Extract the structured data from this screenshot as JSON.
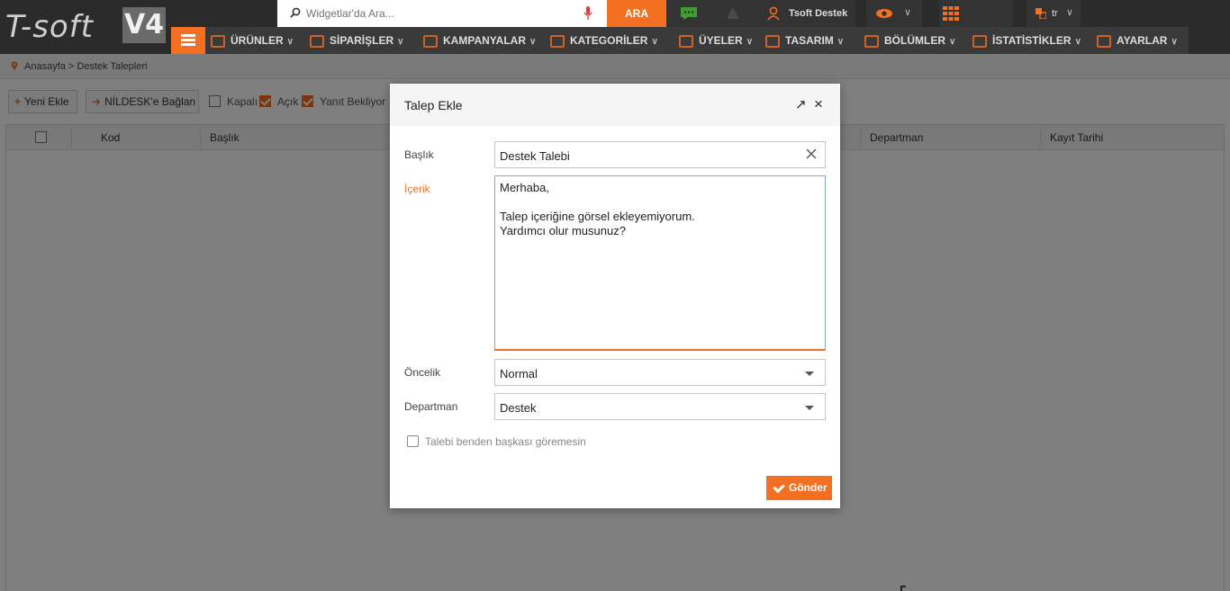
{
  "brand": {
    "logo_text": "T-soft",
    "version": "V4"
  },
  "search": {
    "placeholder": "Widgetlar'da Ara...",
    "button_label": "ARA"
  },
  "user": {
    "name": "Tsoft Destek"
  },
  "language": {
    "code": "tr"
  },
  "nav": {
    "items": [
      {
        "label": "ÜRÜNLER"
      },
      {
        "label": "SİPARİŞLER"
      },
      {
        "label": "KAMPANYALAR"
      },
      {
        "label": "KATEGORİLER"
      },
      {
        "label": "ÜYELER"
      },
      {
        "label": "TASARIM"
      },
      {
        "label": "BÖLÜMLER"
      },
      {
        "label": "İSTATİSTİKLER"
      },
      {
        "label": "AYARLAR"
      }
    ]
  },
  "breadcrumb": {
    "text": "Anasayfa > Destek Talepleri"
  },
  "toolbar": {
    "new_label": "Yeni Ekle",
    "connect_label": "NİLDESK'e Bağlan",
    "filters": [
      {
        "label": "Kapalı",
        "checked": false
      },
      {
        "label": "Açık",
        "checked": true
      },
      {
        "label": "Yanıt Bekliyor",
        "checked": true
      }
    ]
  },
  "grid": {
    "columns": [
      "Kod",
      "Başlık",
      "Departman",
      "Kayıt Tarihi"
    ]
  },
  "modal": {
    "title": "Talep Ekle",
    "fields": {
      "title_label": "Başlık",
      "title_value": "Destek Talebi",
      "content_label": "İçerik",
      "content_value": "Merhaba,\n\nTalep içeriğine görsel ekleyemiyorum.\nYardımcı olur musunuz?",
      "priority_label": "Öncelik",
      "priority_value": "Normal",
      "department_label": "Departman",
      "department_value": "Destek"
    },
    "private_label": "Talebi benden başkası göremesin",
    "private_checked": false,
    "submit_label": "Gönder"
  },
  "colors": {
    "accent": "#f36f21",
    "topbar": "#2b2b2b"
  },
  "icons": [
    "search-icon",
    "mic-icon",
    "chat-icon",
    "warning-icon",
    "user-icon",
    "eye-icon",
    "apps-grid-icon",
    "language-icon",
    "menu-icon",
    "location-pin-icon",
    "plus-icon",
    "link-icon",
    "expand-icon",
    "close-icon",
    "clear-icon",
    "chevron-down-icon",
    "check-icon"
  ]
}
